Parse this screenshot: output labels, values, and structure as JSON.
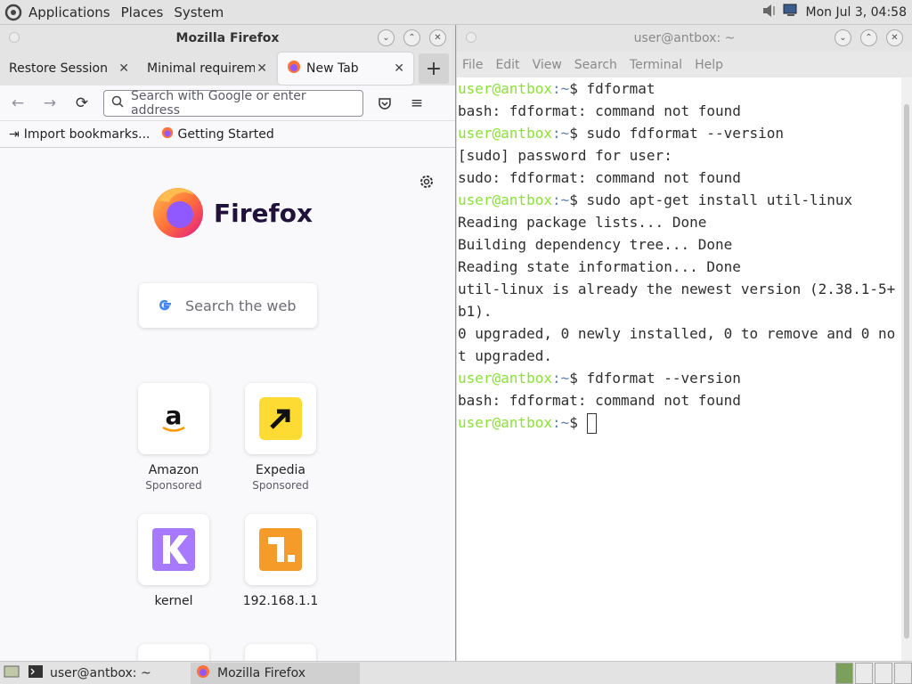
{
  "top_panel": {
    "menus": [
      "Applications",
      "Places",
      "System"
    ],
    "clock": "Mon Jul 3, 04:58"
  },
  "firefox": {
    "window_title": "Mozilla Firefox",
    "tabs": [
      {
        "label": "Restore Session"
      },
      {
        "label": "Minimal requirements"
      },
      {
        "label": "New Tab"
      }
    ],
    "url_placeholder": "Search with Google or enter address",
    "bookmarks": [
      {
        "label": "Import bookmarks..."
      },
      {
        "label": "Getting Started"
      }
    ],
    "wordmark": "Firefox",
    "search_placeholder": "Search the web",
    "tiles": [
      {
        "label": "Amazon",
        "sub": "Sponsored",
        "icon": "amazon-icon"
      },
      {
        "label": "Expedia",
        "sub": "Sponsored",
        "icon": "expedia-icon"
      },
      {
        "label": "kernel",
        "sub": "",
        "icon": "kernel-icon"
      },
      {
        "label": "192.168.1.1",
        "sub": "",
        "icon": "router-icon"
      }
    ]
  },
  "terminal": {
    "window_title": "user@antbox: ~",
    "menus": [
      "File",
      "Edit",
      "View",
      "Search",
      "Terminal",
      "Help"
    ],
    "prompt_user": "user@antbox",
    "prompt_path": ":~",
    "lines": [
      {
        "prompt": true,
        "text": "$ fdformat"
      },
      {
        "prompt": false,
        "text": "bash: fdformat: command not found"
      },
      {
        "prompt": true,
        "text": "$ sudo fdformat --version"
      },
      {
        "prompt": false,
        "text": "[sudo] password for user:"
      },
      {
        "prompt": false,
        "text": "sudo: fdformat: command not found"
      },
      {
        "prompt": true,
        "text": "$ sudo apt-get install util-linux"
      },
      {
        "prompt": false,
        "text": "Reading package lists... Done"
      },
      {
        "prompt": false,
        "text": "Building dependency tree... Done"
      },
      {
        "prompt": false,
        "text": "Reading state information... Done"
      },
      {
        "prompt": false,
        "text": "util-linux is already the newest version (2.38.1-5+b1)."
      },
      {
        "prompt": false,
        "text": "0 upgraded, 0 newly installed, 0 to remove and 0 not upgraded."
      },
      {
        "prompt": true,
        "text": "$ fdformat --version"
      },
      {
        "prompt": false,
        "text": "bash: fdformat: command not found"
      },
      {
        "prompt": true,
        "text": "$ "
      }
    ]
  },
  "bottom_panel": {
    "tasks": [
      {
        "label": "user@antbox: ~"
      },
      {
        "label": "Mozilla Firefox"
      }
    ]
  },
  "colors": {
    "prompt_green": "#8ae234",
    "prompt_blue": "#5e7ea6",
    "firefox_orange": "#ff7139",
    "firefox_purple": "#9059ff"
  }
}
